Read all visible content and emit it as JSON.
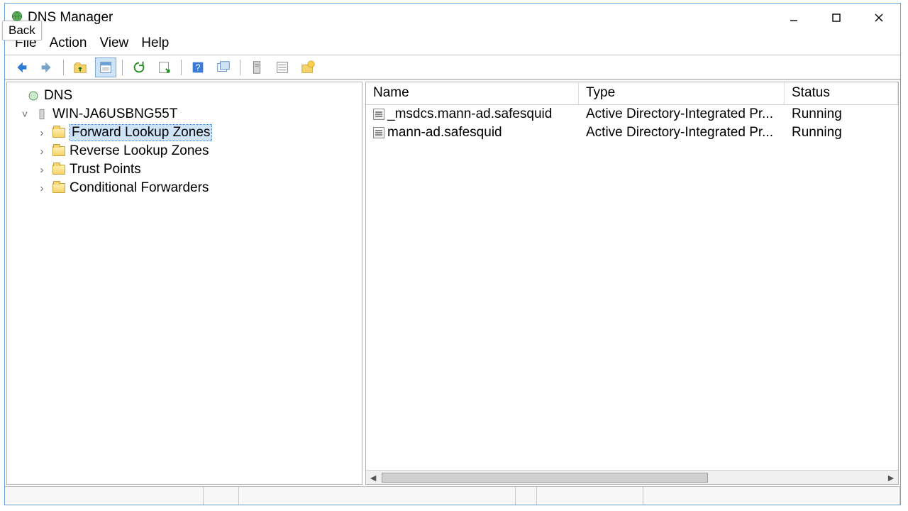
{
  "window": {
    "title": "DNS Manager",
    "back_label": "Back"
  },
  "menu": {
    "file": "File",
    "action": "Action",
    "view": "View",
    "help": "Help"
  },
  "toolbar_icons": {
    "back": "back-arrow-icon",
    "forward": "forward-arrow-icon",
    "up": "up-folder-icon",
    "properties": "properties-icon",
    "refresh": "refresh-icon",
    "export": "export-list-icon",
    "help": "help-icon",
    "newwin": "new-window-icon",
    "col1": "column-icon",
    "col2": "list-icon",
    "addzone": "add-zone-icon"
  },
  "tree": {
    "root": "DNS",
    "server": "WIN-JA6USBNG55T",
    "nodes": [
      {
        "label": "Forward Lookup Zones",
        "selected": true
      },
      {
        "label": "Reverse Lookup Zones",
        "selected": false
      },
      {
        "label": "Trust Points",
        "selected": false
      },
      {
        "label": "Conditional Forwarders",
        "selected": false
      }
    ]
  },
  "list": {
    "columns": {
      "name": "Name",
      "type": "Type",
      "status": "Status"
    },
    "rows": [
      {
        "name": "_msdcs.mann-ad.safesquid",
        "type": "Active Directory-Integrated Pr...",
        "status": "Running"
      },
      {
        "name": "mann-ad.safesquid",
        "type": "Active Directory-Integrated Pr...",
        "status": "Running"
      }
    ]
  }
}
